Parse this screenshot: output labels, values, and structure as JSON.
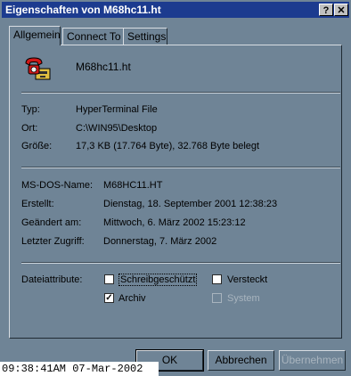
{
  "window": {
    "title": "Eigenschaften von M68hc11.ht",
    "help_glyph": "?",
    "close_glyph": "✕"
  },
  "tabs": [
    {
      "label": "Allgemein",
      "active": true
    },
    {
      "label": "Connect To",
      "active": false
    },
    {
      "label": "Settings",
      "active": false
    }
  ],
  "file": {
    "icon": "hyperterminal-phone-icon",
    "name": "M68hc11.ht"
  },
  "info": {
    "typ_label": "Typ:",
    "typ_value": "HyperTerminal File",
    "ort_label": "Ort:",
    "ort_value": "C:\\WIN95\\Desktop",
    "groesse_label": "Größe:",
    "groesse_value": "17,3 KB (17.764 Byte), 32.768 Byte belegt",
    "dosname_label": "MS-DOS-Name:",
    "dosname_value": "M68HC11.HT",
    "erstellt_label": "Erstellt:",
    "erstellt_value": "Dienstag, 18. September 2001 12:38:23",
    "geaendert_label": "Geändert am:",
    "geaendert_value": "Mittwoch, 6. März 2002 15:23:12",
    "zugriff_label": "Letzter Zugriff:",
    "zugriff_value": "Donnerstag, 7. März 2002"
  },
  "attributes": {
    "label": "Dateiattribute:",
    "schreibgeschuetzt": {
      "label": "Schreibgeschützt",
      "checked": false
    },
    "versteckt": {
      "label": "Versteckt",
      "checked": false
    },
    "archiv": {
      "label": "Archiv",
      "checked": true
    },
    "system": {
      "label": "System",
      "checked": false,
      "disabled": true
    }
  },
  "buttons": {
    "ok": "OK",
    "cancel": "Abbrechen",
    "apply": "Übernehmen"
  },
  "clock": "09:38:41AM 07-Mar-2002",
  "colors": {
    "titlebar": "#1c3b8f",
    "dialog_bg": "#6f8496"
  }
}
